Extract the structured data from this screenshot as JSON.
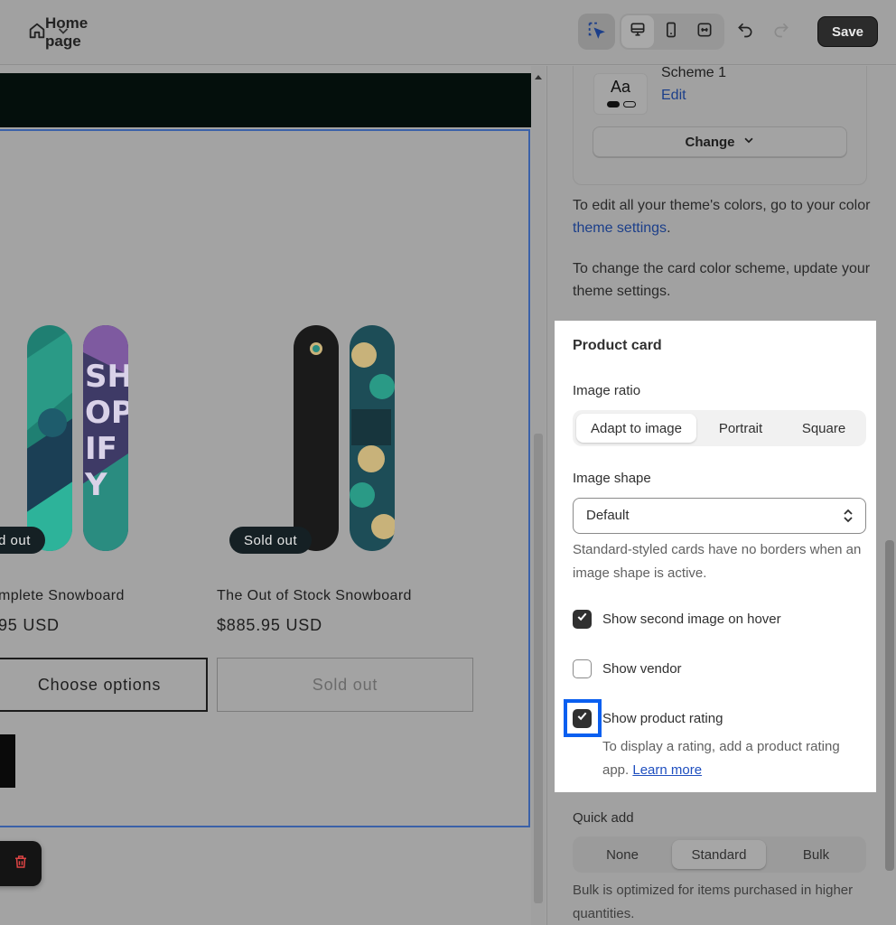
{
  "topbar": {
    "page_selector_label": "Home page",
    "save_label": "Save"
  },
  "preview": {
    "products": [
      {
        "title": "mplete Snowboard",
        "price": "95 USD",
        "badge": "d out",
        "button": "Choose options"
      },
      {
        "title": "The Out of Stock Snowboard",
        "price": "$885.95 USD",
        "badge": "Sold out",
        "button": "Sold out"
      }
    ],
    "snowboard_text": "SHOPIFY"
  },
  "panel": {
    "color_scheme": {
      "preview_text": "Aa",
      "name": "Scheme 1",
      "edit_label": "Edit",
      "change_label": "Change"
    },
    "theme_colors_note": {
      "prefix": "To edit all your theme's colors, go to your color ",
      "link": "theme settings",
      "suffix": "."
    },
    "card_scheme_note": "To change the card color scheme, update your theme settings.",
    "product_card": {
      "title": "Product card",
      "image_ratio_label": "Image ratio",
      "image_ratio_options": [
        "Adapt to image",
        "Portrait",
        "Square"
      ],
      "image_ratio_selected": "Adapt to image",
      "image_shape_label": "Image shape",
      "image_shape_value": "Default",
      "image_shape_help": "Standard-styled cards have no borders when an image shape is active.",
      "checkboxes": [
        {
          "label": "Show second image on hover",
          "checked": true
        },
        {
          "label": "Show vendor",
          "checked": false
        },
        {
          "label": "Show product rating",
          "checked": true
        }
      ],
      "rating_help_prefix": "To display a rating, add a product rating app. ",
      "rating_help_link": "Learn more"
    },
    "quick_add": {
      "label": "Quick add",
      "options": [
        "None",
        "Standard",
        "Bulk"
      ],
      "selected": "Standard",
      "help": "Bulk is optimized for items purchased in higher quantities."
    }
  }
}
